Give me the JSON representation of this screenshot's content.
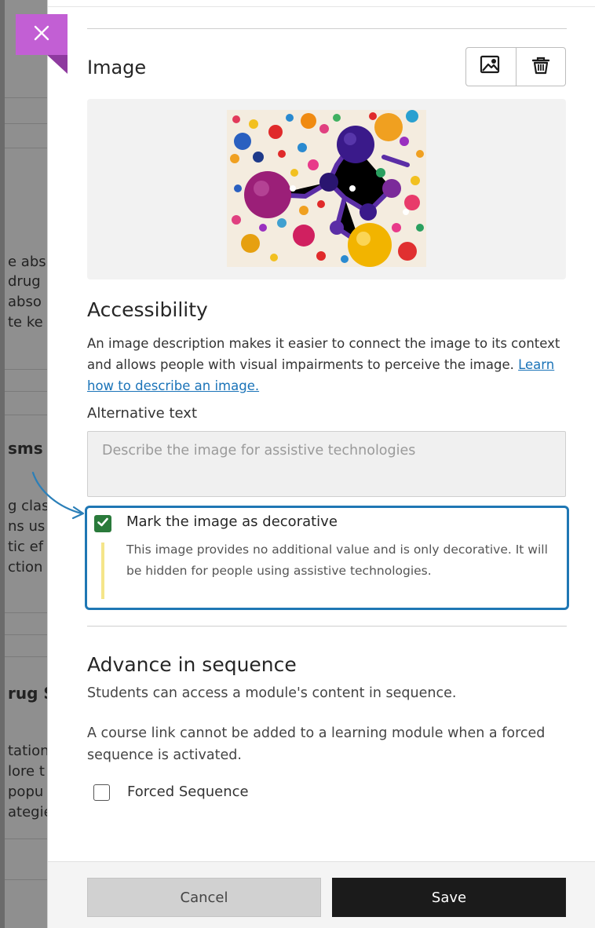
{
  "background_page": {
    "fragments": [
      {
        "text": "e abs",
        "bold": false
      },
      {
        "text": "drug",
        "bold": false
      },
      {
        "text": "abso",
        "bold": false
      },
      {
        "text": "te ke",
        "bold": false
      },
      {
        "text": "sms",
        "bold": true
      },
      {
        "text": "g clas",
        "bold": false
      },
      {
        "text": "ns us",
        "bold": false
      },
      {
        "text": "tic ef",
        "bold": false
      },
      {
        "text": "ction",
        "bold": false
      },
      {
        "text": "rug S",
        "bold": true
      },
      {
        "text": "tation",
        "bold": false
      },
      {
        "text": "lore t",
        "bold": false
      },
      {
        "text": "popu",
        "bold": false
      },
      {
        "text": "ategie",
        "bold": false
      }
    ]
  },
  "close_button": {
    "icon": "close-icon",
    "color": "#c25fd4"
  },
  "image_section": {
    "title": "Image",
    "tools": [
      {
        "name": "replace-image",
        "icon": "image-edit-icon"
      },
      {
        "name": "delete-image",
        "icon": "trash-icon"
      }
    ]
  },
  "accessibility": {
    "title": "Accessibility",
    "description": "An image description makes it easier to connect the image to its context and allows people with visual impairments to perceive the image.",
    "link_text": "Learn how to describe an image.",
    "alt_label": "Alternative text",
    "alt_placeholder": "Describe the image for assistive technologies",
    "alt_value": "",
    "decorative": {
      "label": "Mark the image as decorative",
      "checked": true,
      "help": "This image provides no additional value and is only decorative. It will be hidden for people using assistive technologies."
    }
  },
  "advance": {
    "title": "Advance in sequence",
    "line1": "Students can access a module's content in sequence.",
    "line2": "A course link cannot be added to a learning module when a forced sequence is activated.",
    "forced_label": "Forced Sequence",
    "forced_checked": false
  },
  "footer": {
    "cancel_label": "Cancel",
    "save_label": "Save"
  },
  "colors": {
    "accent_blue": "#1f77b4",
    "check_green": "#2a7a3b",
    "close_purple": "#c25fd4",
    "save_dark": "#1b1b1b",
    "help_bar": "#f5e58a"
  }
}
